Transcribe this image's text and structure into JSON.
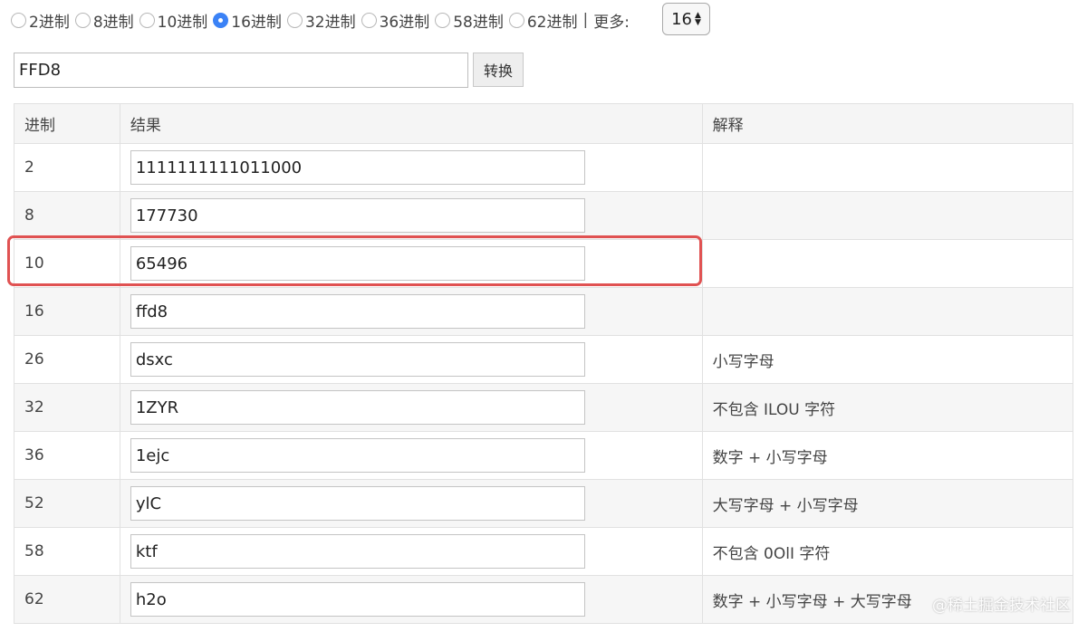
{
  "radix_options": {
    "opt2": "2进制",
    "opt8": "8进制",
    "opt10": "10进制",
    "opt16": "16进制",
    "opt32": "32进制",
    "opt36": "36进制",
    "opt58": "58进制",
    "opt62": "62进制",
    "selected": "16进制"
  },
  "separator": "|",
  "more_label": "更多:",
  "more_select_value": "16",
  "input_value": "FFD8",
  "convert_label": "转换",
  "table": {
    "headers": {
      "radix": "进制",
      "result": "结果",
      "note": "解释"
    },
    "rows": [
      {
        "radix": "2",
        "result": "1111111111011000",
        "note": ""
      },
      {
        "radix": "8",
        "result": "177730",
        "note": ""
      },
      {
        "radix": "10",
        "result": "65496",
        "note": ""
      },
      {
        "radix": "16",
        "result": "ffd8",
        "note": ""
      },
      {
        "radix": "26",
        "result": "dsxc",
        "note": "小写字母"
      },
      {
        "radix": "32",
        "result": "1ZYR",
        "note": "不包含 ILOU 字符"
      },
      {
        "radix": "36",
        "result": "1ejc",
        "note": "数字 + 小写字母"
      },
      {
        "radix": "52",
        "result": "ylC",
        "note": "大写字母 + 小写字母"
      },
      {
        "radix": "58",
        "result": "ktf",
        "note": "不包含 0OlI 字符"
      },
      {
        "radix": "62",
        "result": "h2o",
        "note": "数字 + 小写字母 + 大写字母"
      }
    ]
  },
  "highlight_color": "#e05252",
  "accent_color": "#3b82f6",
  "watermark": "@稀土掘金技术社区"
}
